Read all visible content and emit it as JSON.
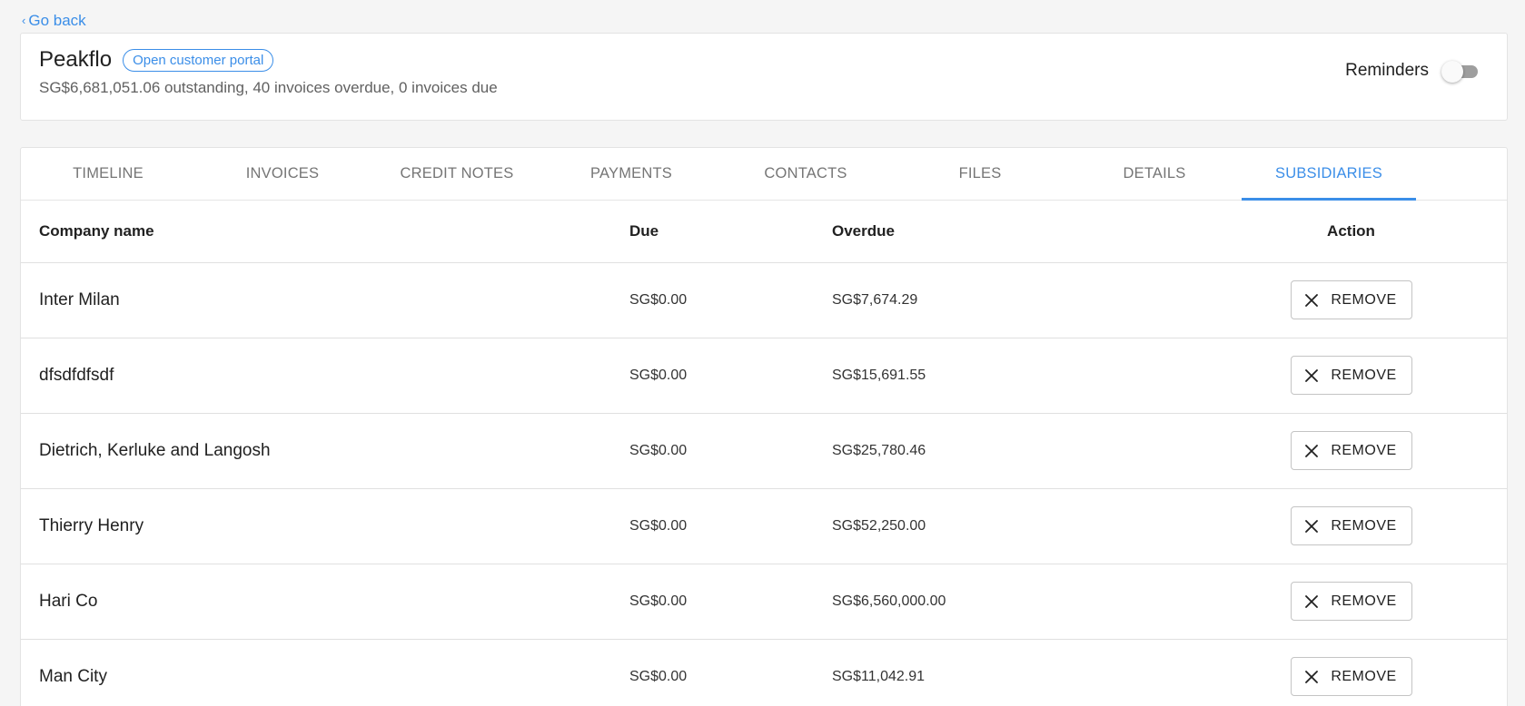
{
  "back": {
    "label": "Go back"
  },
  "header": {
    "company_name": "Peakflo",
    "portal_label": "Open customer portal",
    "summary": "SG$6,681,051.06 outstanding, 40 invoices overdue, 0 invoices due",
    "reminders_label": "Reminders",
    "reminders_enabled": false
  },
  "tabs": [
    {
      "label": "TIMELINE",
      "active": false
    },
    {
      "label": "INVOICES",
      "active": false
    },
    {
      "label": "CREDIT NOTES",
      "active": false
    },
    {
      "label": "PAYMENTS",
      "active": false
    },
    {
      "label": "CONTACTS",
      "active": false
    },
    {
      "label": "FILES",
      "active": false
    },
    {
      "label": "DETAILS",
      "active": false
    },
    {
      "label": "SUBSIDIARIES",
      "active": true
    }
  ],
  "table": {
    "headers": {
      "name": "Company name",
      "due": "Due",
      "overdue": "Overdue",
      "action": "Action"
    },
    "remove_label": "REMOVE",
    "rows": [
      {
        "name": "Inter Milan",
        "due": "SG$0.00",
        "overdue": "SG$7,674.29"
      },
      {
        "name": "dfsdfdfsdf",
        "due": "SG$0.00",
        "overdue": "SG$15,691.55"
      },
      {
        "name": "Dietrich, Kerluke and Langosh",
        "due": "SG$0.00",
        "overdue": "SG$25,780.46"
      },
      {
        "name": "Thierry Henry",
        "due": "SG$0.00",
        "overdue": "SG$52,250.00"
      },
      {
        "name": "Hari Co",
        "due": "SG$0.00",
        "overdue": "SG$6,560,000.00"
      },
      {
        "name": "Man City",
        "due": "SG$0.00",
        "overdue": "SG$11,042.91"
      }
    ]
  },
  "colors": {
    "accent": "#3b8ee8",
    "toggle_off": "#9e9e9e"
  }
}
